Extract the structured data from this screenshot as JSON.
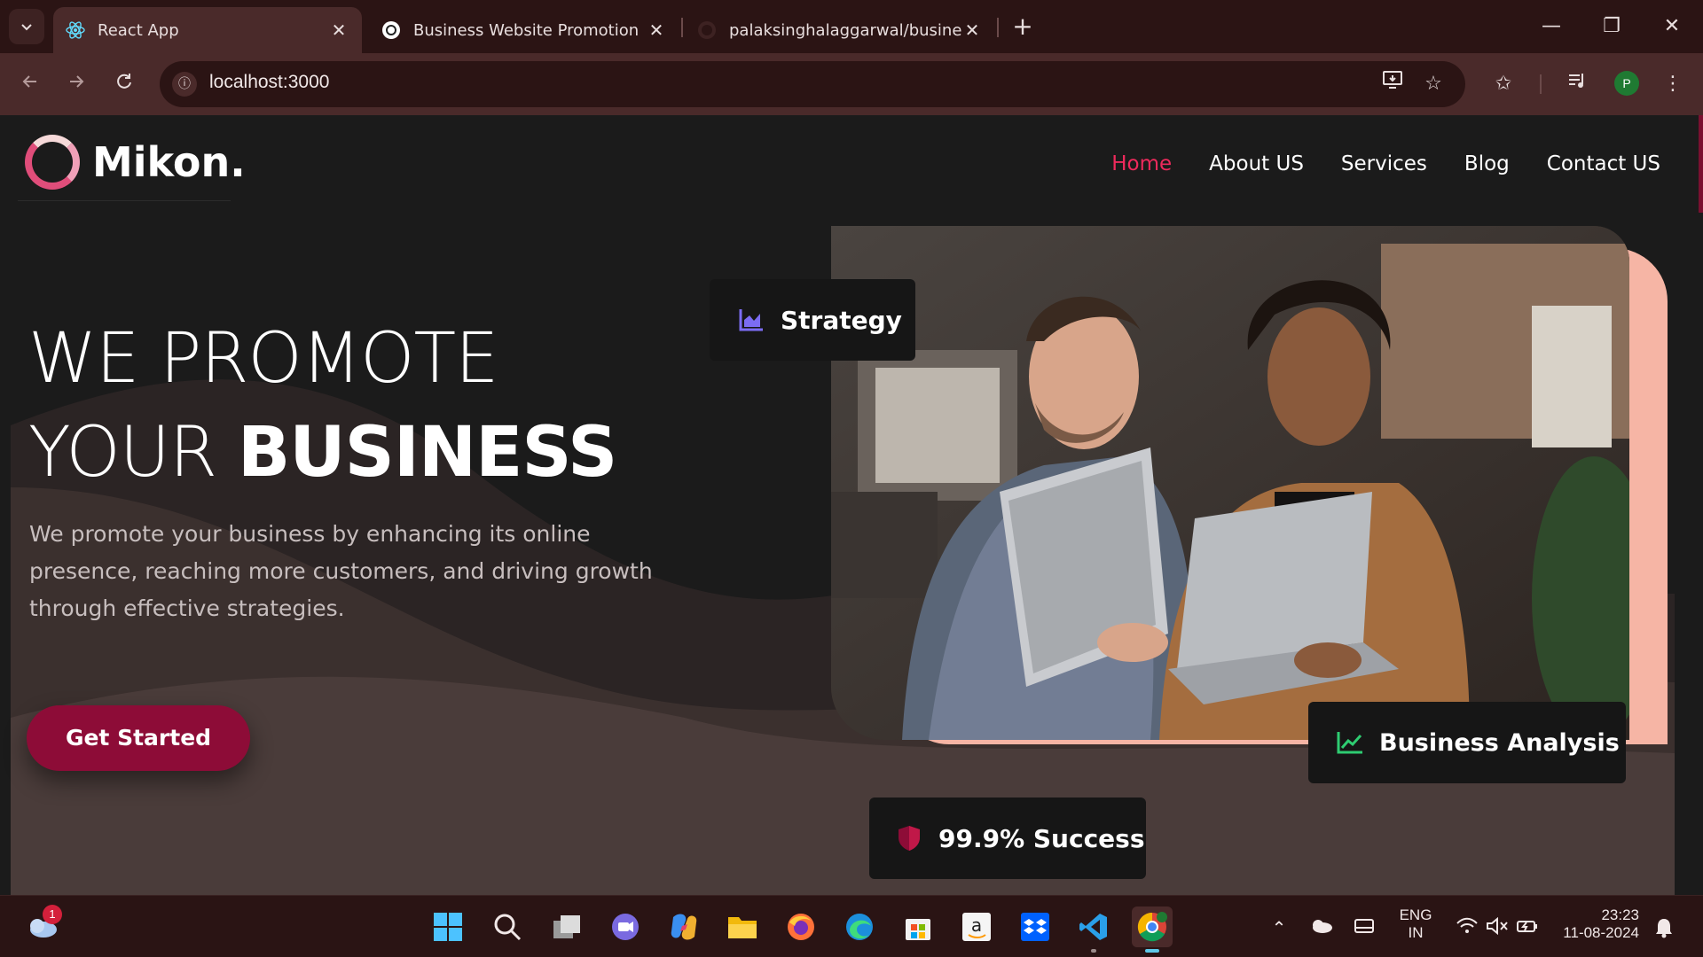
{
  "browser": {
    "tabs": [
      {
        "title": "React App",
        "icon": "react-icon",
        "active": true
      },
      {
        "title": "Business Website Promotion",
        "icon": "chatgpt-icon",
        "active": false
      },
      {
        "title": "palaksinghalaggarwal/business",
        "icon": "github-icon",
        "active": false
      }
    ],
    "url": "localhost:3000",
    "profile_initial": "P"
  },
  "site": {
    "logo_text": "Mikon.",
    "nav": [
      "Home",
      "About US",
      "Services",
      "Blog",
      "Contact US"
    ],
    "active_nav": "Home",
    "hero": {
      "title_line1": "WE PROMOTE",
      "title_line2_light": "YOUR ",
      "title_line2_bold": "BUSINESS",
      "description": "We promote your business by enhancing its online presence, reaching more customers, and driving growth through effective strategies.",
      "cta_label": "Get Started"
    },
    "cards": {
      "strategy": "Strategy",
      "analysis": "Business Analysis",
      "success": "99.9% Success"
    },
    "colors": {
      "accent": "#ee2a5c",
      "cta": "#8d0c37",
      "photo_backdrop": "#f6b5a5",
      "background": "#1b1b1b"
    }
  },
  "taskbar": {
    "weather_badge": "1",
    "language_line1": "ENG",
    "language_line2": "IN",
    "time": "23:23",
    "date": "11-08-2024"
  }
}
